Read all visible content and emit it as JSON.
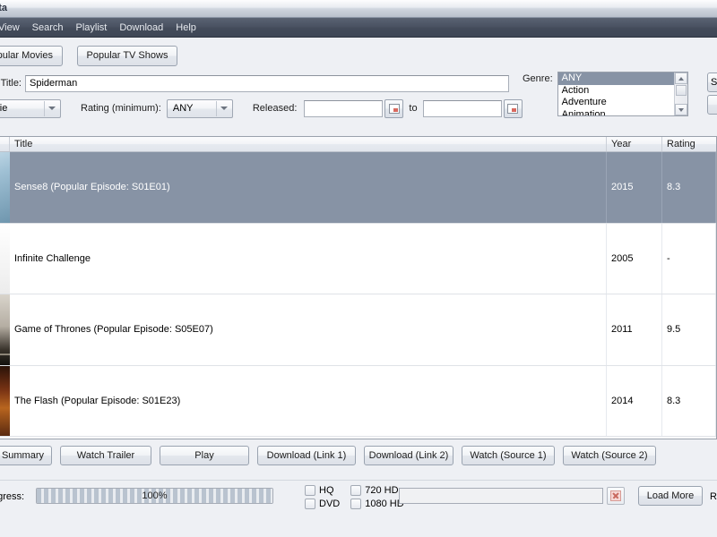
{
  "window": {
    "title": "asta"
  },
  "menubar": {
    "items": [
      {
        "label": "View"
      },
      {
        "label": "Search"
      },
      {
        "label": "Playlist"
      },
      {
        "label": "Download"
      },
      {
        "label": "Help"
      }
    ]
  },
  "tabs": [
    {
      "label": "Popular Movies"
    },
    {
      "label": "Popular TV Shows"
    }
  ],
  "filters": {
    "title_label": "Title:",
    "title_value": "Spiderman",
    "title_placeholder": "",
    "type_value": "Movie",
    "rating_label": "Rating (minimum):",
    "rating_value": "ANY",
    "released_label": "Released:",
    "released_from": "",
    "released_to": "",
    "released_separator": "to",
    "genre_label": "Genre:",
    "genre_options": [
      "ANY",
      "Action",
      "Adventure",
      "Animation"
    ],
    "genre_selected": "ANY",
    "edge_buttons": [
      {
        "label": "S"
      },
      {
        "label": ""
      }
    ]
  },
  "table": {
    "columns": [
      "",
      "Title",
      "Year",
      "Rating"
    ],
    "rows": [
      {
        "poster": "sense8-poster",
        "title": "Sense8 (Popular Episode: S01E01)",
        "year": "2015",
        "rating": "8.3",
        "selected": true
      },
      {
        "poster": "infinite-challenge-poster",
        "title": "Infinite Challenge",
        "year": "2005",
        "rating": "-",
        "selected": false
      },
      {
        "poster": "game-of-thrones-poster",
        "title": "Game of Thrones (Popular Episode: S05E07)",
        "year": "2011",
        "rating": "9.5",
        "selected": false
      },
      {
        "poster": "the-flash-poster",
        "title": "The Flash (Popular Episode: S01E23)",
        "year": "2014",
        "rating": "8.3",
        "selected": false
      }
    ]
  },
  "actions": [
    {
      "label": "Summary"
    },
    {
      "label": "Watch Trailer"
    },
    {
      "label": "Play"
    },
    {
      "label": "Download (Link 1)"
    },
    {
      "label": "Download (Link 2)"
    },
    {
      "label": "Watch (Source 1)"
    },
    {
      "label": "Watch (Source 2)"
    }
  ],
  "statusbar": {
    "progress_label": "Progress:",
    "progress_text": "100%",
    "progress_percent": 100,
    "quality_checks": [
      {
        "label": "HQ",
        "checked": false
      },
      {
        "label": "720 HD",
        "checked": false
      },
      {
        "label": "DVD",
        "checked": false
      },
      {
        "label": "1080 HD",
        "checked": false
      }
    ],
    "search_value": "",
    "search_placeholder": "",
    "clear_icon": "close-x-icon",
    "load_more_label": "Load More",
    "results_label": "R"
  },
  "colors": {
    "menubar": "#4a5262",
    "selection": "#8793a5",
    "content_bg": "#eef0f4",
    "accent_red": "#c8695f"
  }
}
